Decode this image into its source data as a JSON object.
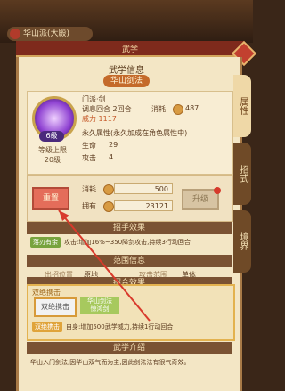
{
  "topbar": {
    "location": "华山派(大殿)"
  },
  "header": {
    "bar_label": "武学"
  },
  "panel": {
    "title": "武学信息",
    "sub_badge": "华山剑法",
    "tabs": [
      "属性",
      "招式",
      "境界"
    ]
  },
  "skill": {
    "level_badge": "6级",
    "cap_label": "等级上限",
    "cap_value": "20级",
    "type": "门派·剑",
    "gap_rounds": "调息回合 2回合",
    "mp_cost_label": "消耗",
    "mp_cost": "487",
    "power": "威力 1117",
    "perm_attr": "永久属性(永久加成在角色属性中)",
    "hp_label": "生命",
    "hp_value": "29",
    "atk_label": "攻击",
    "atk_value": "4"
  },
  "upgrade": {
    "reset_label": "重置",
    "upgrade_label": "升级",
    "cost_label": "消耗",
    "cost_value": "500",
    "own_label": "拥有",
    "own_value": "23121"
  },
  "sections": {
    "bonus": "招手效果",
    "range": "范围信息",
    "combo": "招合效果",
    "intro": "武学介绍"
  },
  "effect": {
    "tag": "落刃有余",
    "text": "攻击:增加16%~350降剑攻击,持续3行动回合"
  },
  "range": {
    "pos_label": "出招位置",
    "pos_value": "原地",
    "area_label": "攻击范围",
    "area_value": "单体"
  },
  "combo": {
    "name": "双绝携击",
    "badge1": "双绝携击",
    "badge2": "华山剑法",
    "badge2_line2": "惊鸿剑",
    "tag": "双绝携击",
    "text": "自身:增加500武学威力,持续1行动回合"
  },
  "intro": {
    "text": "华山入门剑法,因华山双气而为主,因此剑法法有很气奇效。"
  }
}
